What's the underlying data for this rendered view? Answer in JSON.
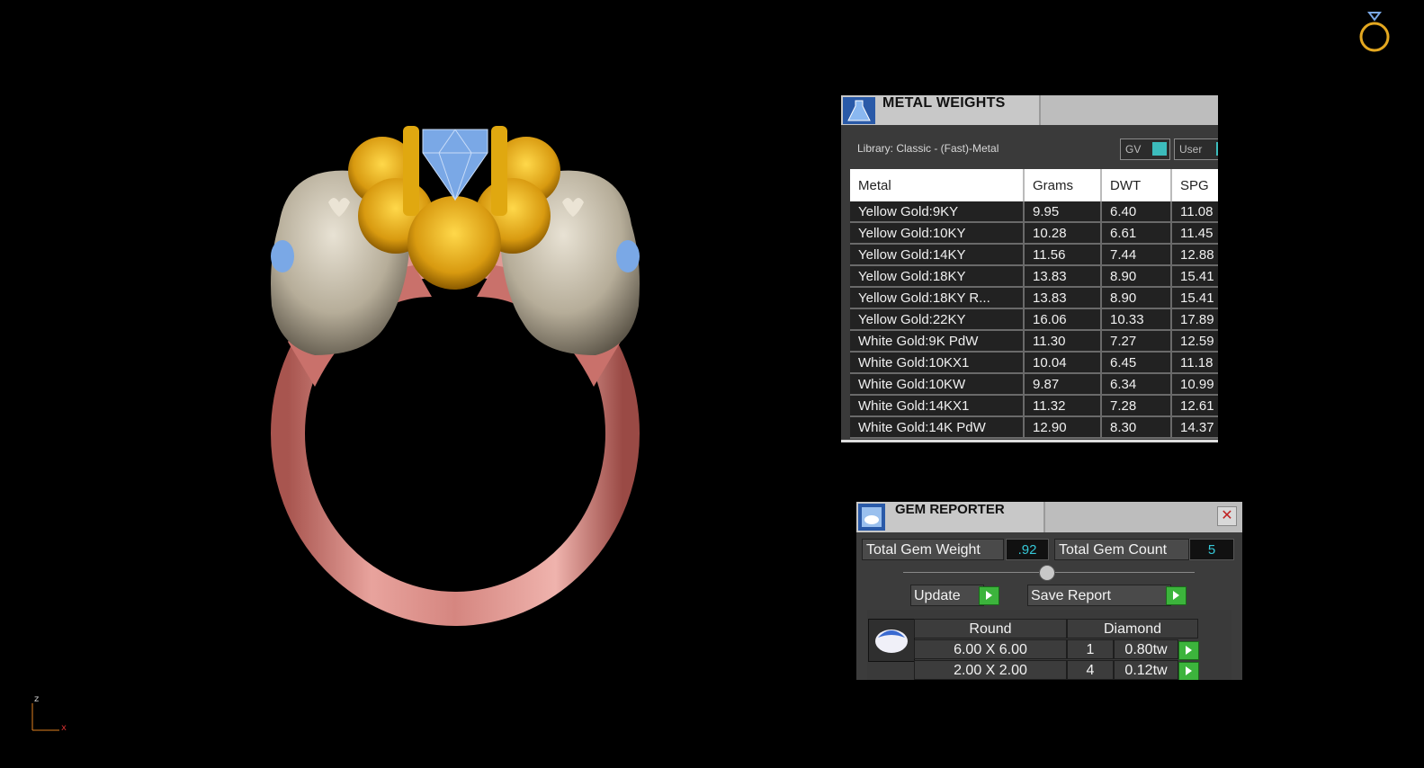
{
  "viewport": {
    "axis_labels": {
      "z": "z",
      "x": "x"
    },
    "colors": {
      "background": "#000000",
      "band": "#d98a85",
      "skull": "#bdb5a3",
      "gold": "#e4b020",
      "gem": "#7aa8e6"
    }
  },
  "metal_weights": {
    "title": "METAL WEIGHTS",
    "library_label": "Library: Classic - (Fast)-Metal",
    "gv_label": "GV",
    "user_label": "User",
    "columns": [
      "Metal",
      "Grams",
      "DWT",
      "SPG"
    ],
    "rows": [
      {
        "metal": "Yellow Gold:9KY",
        "grams": "9.95",
        "dwt": "6.40",
        "spg": "11.08"
      },
      {
        "metal": "Yellow Gold:10KY",
        "grams": "10.28",
        "dwt": "6.61",
        "spg": "11.45"
      },
      {
        "metal": "Yellow Gold:14KY",
        "grams": "11.56",
        "dwt": "7.44",
        "spg": "12.88"
      },
      {
        "metal": "Yellow Gold:18KY",
        "grams": "13.83",
        "dwt": "8.90",
        "spg": "15.41"
      },
      {
        "metal": "Yellow Gold:18KY R...",
        "grams": "13.83",
        "dwt": "8.90",
        "spg": "15.41"
      },
      {
        "metal": "Yellow Gold:22KY",
        "grams": "16.06",
        "dwt": "10.33",
        "spg": "17.89"
      },
      {
        "metal": "White Gold:9K PdW",
        "grams": "11.30",
        "dwt": "7.27",
        "spg": "12.59"
      },
      {
        "metal": "White Gold:10KX1",
        "grams": "10.04",
        "dwt": "6.45",
        "spg": "11.18"
      },
      {
        "metal": "White Gold:10KW",
        "grams": "9.87",
        "dwt": "6.34",
        "spg": "10.99"
      },
      {
        "metal": "White Gold:14KX1",
        "grams": "11.32",
        "dwt": "7.28",
        "spg": "12.61"
      },
      {
        "metal": "White Gold:14K PdW",
        "grams": "12.90",
        "dwt": "8.30",
        "spg": "14.37"
      }
    ]
  },
  "gem_reporter": {
    "title": "GEM REPORTER",
    "total_weight_label": "Total Gem Weight",
    "total_weight_value": ".92",
    "total_count_label": "Total Gem Count",
    "total_count_value": "5",
    "update_label": "Update",
    "save_label": "Save Report",
    "shape_header": "Round",
    "type_header": "Diamond",
    "gems": [
      {
        "size": "6.00 X 6.00",
        "count": "1",
        "weight": "0.80tw"
      },
      {
        "size": "2.00 X 2.00",
        "count": "4",
        "weight": "0.12tw"
      }
    ]
  }
}
